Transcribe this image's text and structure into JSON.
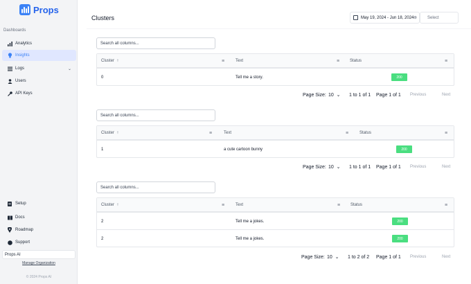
{
  "brand": {
    "name": "Props",
    "accent": "#3b82f6"
  },
  "sidebar": {
    "section_label": "Dashboards",
    "items": [
      {
        "label": "Analytics",
        "icon": "bar-chart-icon"
      },
      {
        "label": "Insights",
        "icon": "lightbulb-icon",
        "active": true
      },
      {
        "label": "Logs",
        "icon": "list-icon",
        "expandable": true
      },
      {
        "label": "Users",
        "icon": "user-icon"
      },
      {
        "label": "API Keys",
        "icon": "key-icon"
      }
    ],
    "bottom_items": [
      {
        "label": "Setup",
        "icon": "document-icon"
      },
      {
        "label": "Docs",
        "icon": "book-icon"
      },
      {
        "label": "Roadmap",
        "icon": "map-pin-icon"
      },
      {
        "label": "Support",
        "icon": "help-icon"
      }
    ],
    "org_selected": "Props AI",
    "manage_org": "Manage Organization",
    "copyright": "© 2024 Props AI"
  },
  "header": {
    "title": "Clusters",
    "date_range": "May 19, 2024 - Jun 18, 2024",
    "select_label": "Select"
  },
  "tables": [
    {
      "search_placeholder": "Search all columns...",
      "columns": [
        "Cluster",
        "Text",
        "Status"
      ],
      "sort_indicator": "↑",
      "rows": [
        {
          "cluster": "0",
          "text": "Tell me a story.",
          "status": "200"
        }
      ],
      "pager": {
        "page_size_label": "Page Size:",
        "page_size": "10",
        "range": "1 to 1 of 1",
        "page": "Page 1 of 1",
        "prev": "Previous",
        "next": "Next"
      }
    },
    {
      "search_placeholder": "Search all columns...",
      "columns": [
        "Cluster",
        "Text",
        "Status"
      ],
      "sort_indicator": "↑",
      "rows": [
        {
          "cluster": "1",
          "text": "a cute cartoon bunny",
          "status": "200"
        }
      ],
      "pager": {
        "page_size_label": "Page Size:",
        "page_size": "10",
        "range": "1 to 1 of 1",
        "page": "Page 1 of 1",
        "prev": "Previous",
        "next": "Next"
      }
    },
    {
      "search_placeholder": "Search all columns...",
      "columns": [
        "Cluster",
        "Text",
        "Status"
      ],
      "sort_indicator": "↑",
      "rows": [
        {
          "cluster": "2",
          "text": "Tell me a jokes.",
          "status": "200"
        },
        {
          "cluster": "2",
          "text": "Tell me a jokes.",
          "status": "200"
        }
      ],
      "pager": {
        "page_size_label": "Page Size:",
        "page_size": "10",
        "range": "1 to 2 of 2",
        "page": "Page 1 of 1",
        "prev": "Previous",
        "next": "Next"
      }
    }
  ],
  "colors": {
    "status_badge": "#4ade80",
    "active_nav_bg": "#e0e7ff"
  }
}
